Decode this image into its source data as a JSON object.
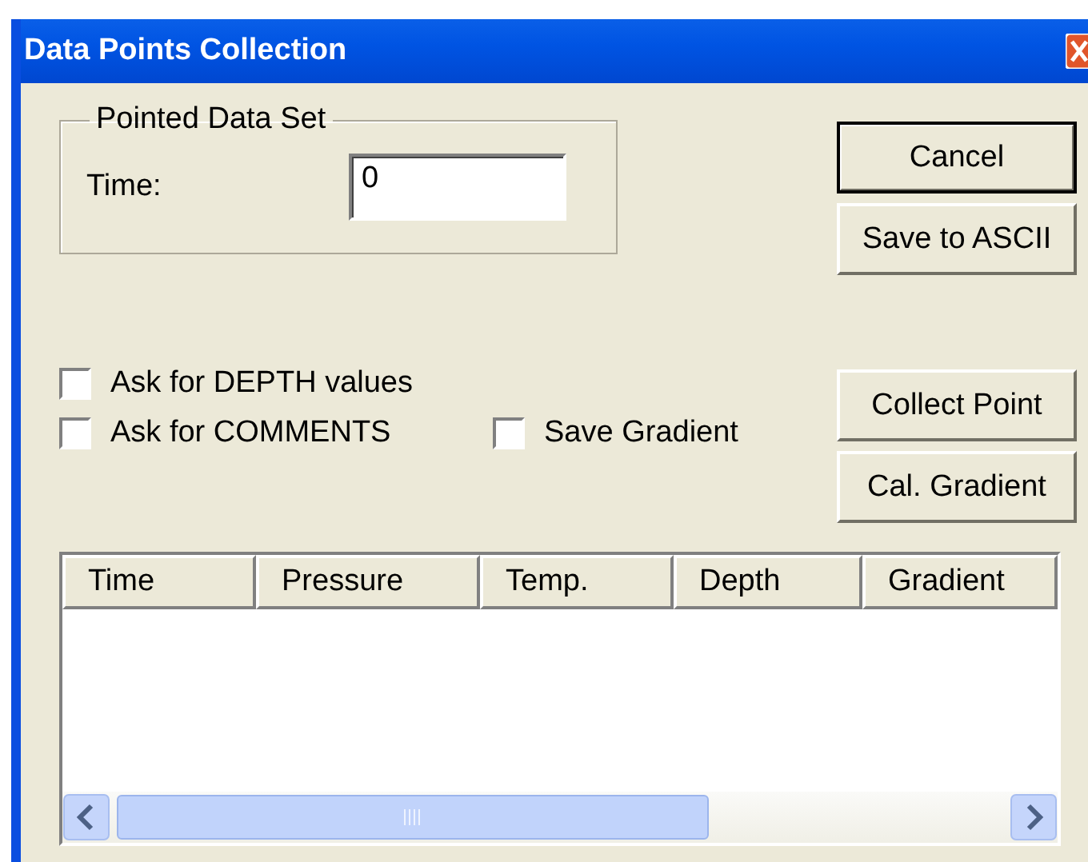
{
  "window": {
    "title": "Data Points Collection"
  },
  "group": {
    "title": "Pointed Data Set",
    "field_label": "Time:",
    "field_value": "0"
  },
  "buttons": [
    {
      "label": "Cancel",
      "default": true
    },
    {
      "label": "Save to ASCII",
      "default": false
    },
    {
      "label": "Collect Point",
      "default": false
    },
    {
      "label": "Cal. Gradient",
      "default": false
    }
  ],
  "checkboxes": [
    {
      "label": "Ask for DEPTH values",
      "checked": false
    },
    {
      "label": "Ask for COMMENTS",
      "checked": false
    },
    {
      "label": "Save Gradient",
      "checked": false
    }
  ],
  "table": {
    "columns": [
      "Time",
      "Pressure",
      "Temp.",
      "Depth",
      "Gradient"
    ]
  }
}
